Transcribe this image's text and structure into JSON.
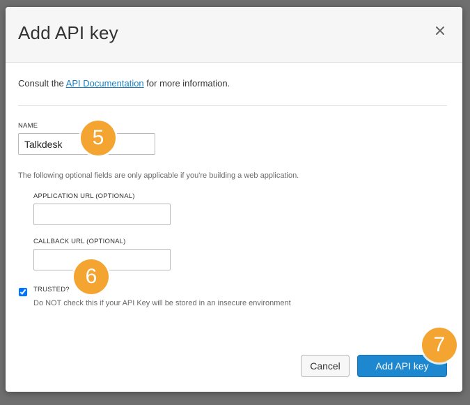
{
  "modal": {
    "title": "Add API key",
    "close_icon": "close-icon"
  },
  "consult": {
    "prefix": "Consult the ",
    "link_text": "API Documentation",
    "suffix": " for more information."
  },
  "fields": {
    "name": {
      "label": "NAME",
      "value": "Talkdesk"
    },
    "optional_hint": "The following optional fields are only applicable if you're building a web application.",
    "application_url": {
      "label": "APPLICATION URL (OPTIONAL)",
      "value": ""
    },
    "callback_url": {
      "label": "CALLBACK URL (OPTIONAL)",
      "value": ""
    },
    "trusted": {
      "label": "TRUSTED?",
      "checked": true,
      "help": "Do NOT check this if your API Key will be stored in an insecure environment"
    }
  },
  "annotations": {
    "step_5": "5",
    "step_6": "6",
    "step_7": "7",
    "color": "#f4a431"
  },
  "footer": {
    "cancel_label": "Cancel",
    "submit_label": "Add API key"
  },
  "colors": {
    "primary_button": "#1d88d0",
    "link": "#1a7fc1",
    "overlay": "#6f6f6f"
  }
}
